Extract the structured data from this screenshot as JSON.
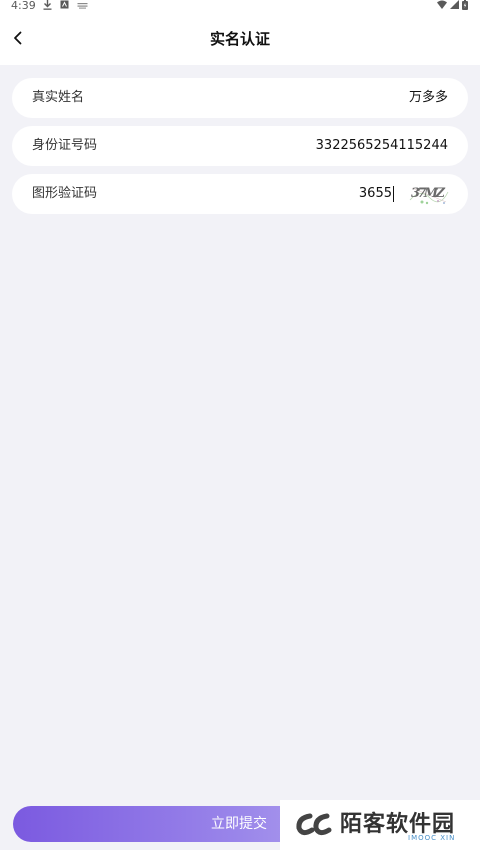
{
  "status_bar": {
    "time": "4:39",
    "left_icons": [
      "download-icon",
      "app-icon",
      "notification-icon"
    ],
    "right_icons": [
      "wifi-icon",
      "signal-icon",
      "battery-icon"
    ]
  },
  "header": {
    "title": "实名认证",
    "back_icon": "chevron-left-icon"
  },
  "form": {
    "name": {
      "label": "真实姓名",
      "value": "万多多"
    },
    "id_number": {
      "label": "身份证号码",
      "value": "3322565254115244"
    },
    "captcha": {
      "label": "图形验证码",
      "value": "3655",
      "image_text": "37MZ"
    }
  },
  "submit": {
    "label": "立即提交"
  },
  "watermark": {
    "text": "陌客软件园",
    "subtext": "IMOOC XIN"
  },
  "colors": {
    "background": "#f2f2f7",
    "button_start": "#7b5ae0",
    "button_end": "#c7bdf2"
  }
}
